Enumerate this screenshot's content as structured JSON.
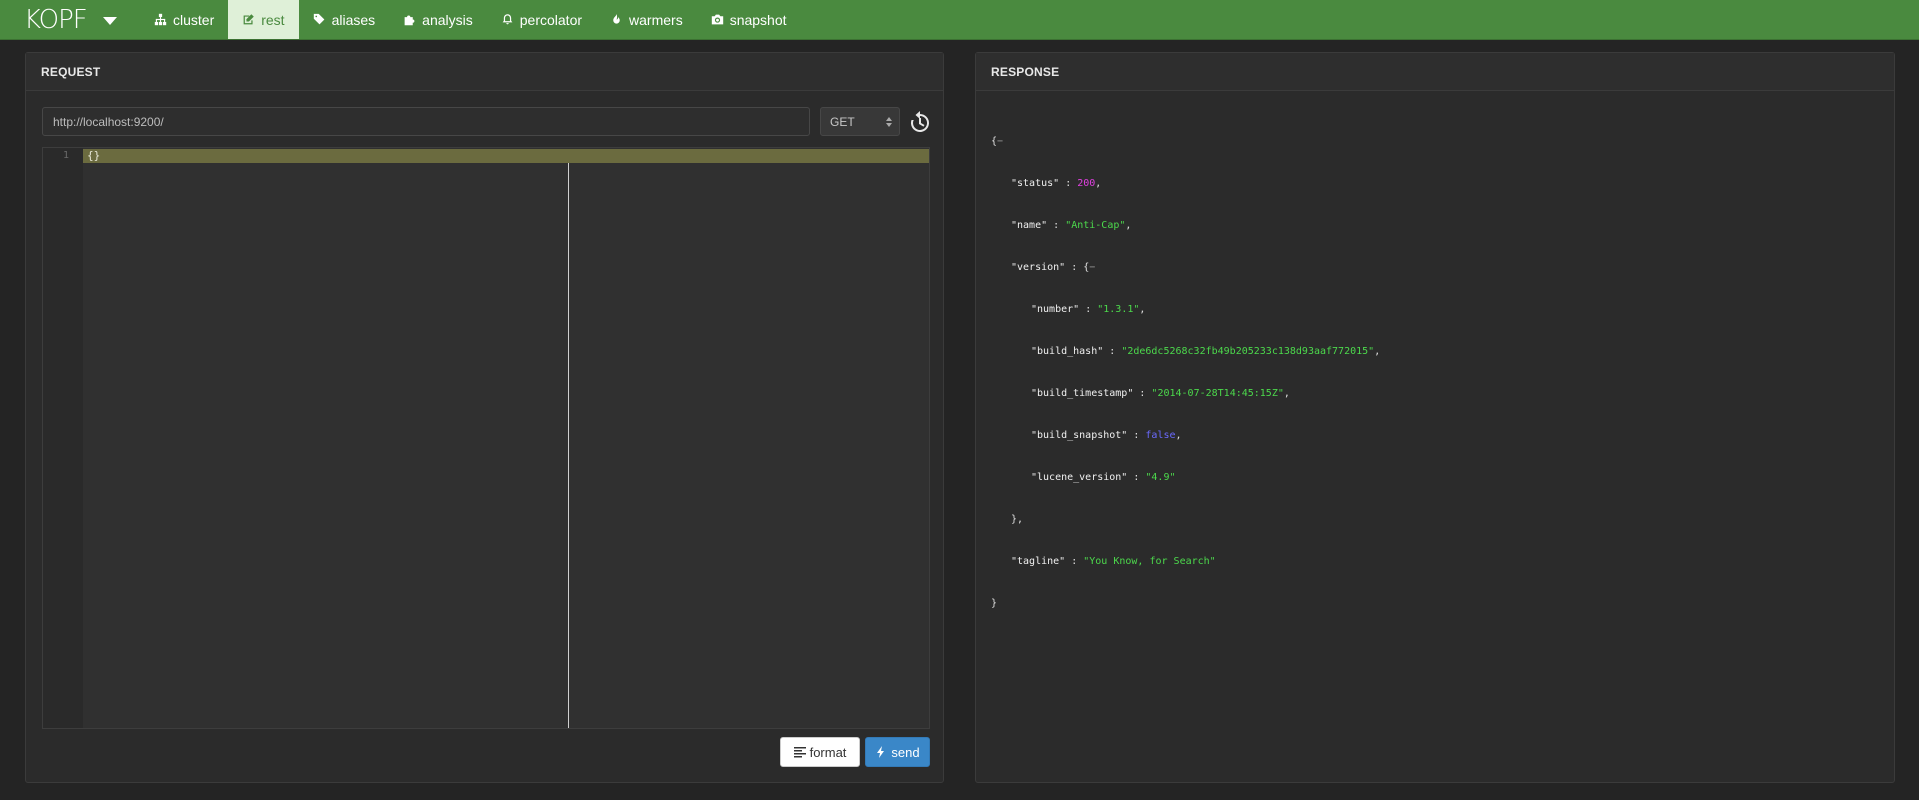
{
  "app": {
    "brand": "KOPF"
  },
  "nav": {
    "items": [
      {
        "label": "cluster",
        "icon": "sitemap-icon"
      },
      {
        "label": "rest",
        "icon": "edit-icon",
        "active": true
      },
      {
        "label": "aliases",
        "icon": "tags-icon"
      },
      {
        "label": "analysis",
        "icon": "puzzle-icon"
      },
      {
        "label": "percolator",
        "icon": "bell-icon"
      },
      {
        "label": "warmers",
        "icon": "fire-icon"
      },
      {
        "label": "snapshot",
        "icon": "camera-icon"
      }
    ]
  },
  "request": {
    "heading": "REQUEST",
    "url": "http://localhost:9200/",
    "method": "GET",
    "editor": {
      "line_number": "1",
      "content": "{}"
    },
    "format_label": "format",
    "send_label": "send"
  },
  "response": {
    "heading": "RESPONSE",
    "open_brace": "{",
    "status_key": "\"status\"",
    "status_value": "200",
    "name_key": "\"name\"",
    "name_value": "\"Anti-Cap\"",
    "version_key": "\"version\"",
    "number_key": "\"number\"",
    "number_value": "\"1.3.1\"",
    "build_hash_key": "\"build_hash\"",
    "build_hash_value": "\"2de6dc5268c32fb49b205233c138d93aaf772015\"",
    "build_timestamp_key": "\"build_timestamp\"",
    "build_timestamp_value": "\"2014-07-28T14:45:15Z\"",
    "build_snapshot_key": "\"build_snapshot\"",
    "build_snapshot_value": "false",
    "lucene_version_key": "\"lucene_version\"",
    "lucene_version_value": "\"4.9\"",
    "version_close": "},",
    "tagline_key": "\"tagline\"",
    "tagline_value": "\"You Know, for Search\"",
    "close_brace": "}"
  },
  "colors": {
    "navbar": "#4a8a3f",
    "active_tab_bg": "#dff0d8",
    "send_button": "#3a87c8",
    "json_number": "#e040e0",
    "json_string": "#4cd94c",
    "json_boolean": "#6a6aff"
  }
}
